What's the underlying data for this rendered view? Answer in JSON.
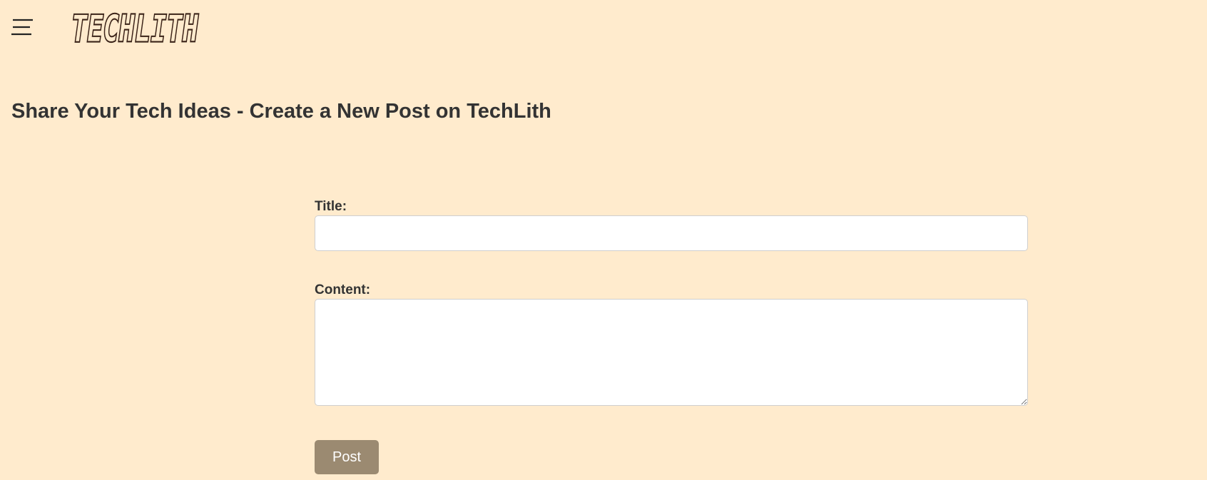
{
  "header": {
    "menu_icon": "hamburger-menu-icon",
    "logo_text": "TECHLITH"
  },
  "page": {
    "title": "Share Your Tech Ideas - Create a New Post on TechLith"
  },
  "form": {
    "title_label": "Title:",
    "title_value": "",
    "content_label": "Content:",
    "content_value": "",
    "submit_label": "Post"
  },
  "colors": {
    "background": "#ffebcd",
    "text": "#333333",
    "button": "#9b8a71",
    "logo": "#3a2318"
  }
}
